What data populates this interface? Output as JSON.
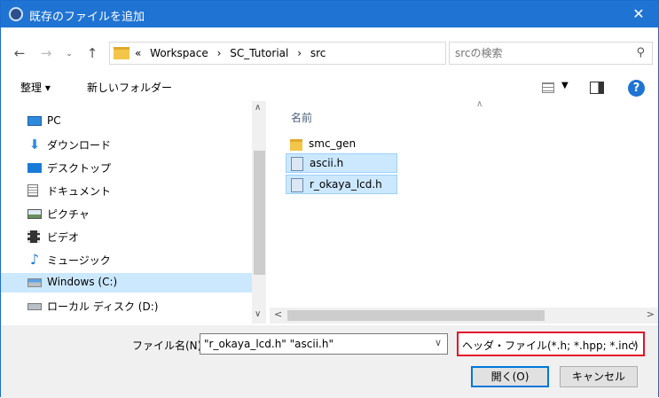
{
  "window": {
    "title": "既存のファイルを追加",
    "close_label": "✕"
  },
  "address": {
    "overflow": "«",
    "crumbs": [
      "Workspace",
      "SC_Tutorial",
      "src"
    ],
    "separator": "›",
    "search_placeholder": "srcの検索"
  },
  "toolbar": {
    "organize": "整理 ▾",
    "new_folder": "新しいフォルダー"
  },
  "nav_items": [
    {
      "label": "PC",
      "icon": "pc-icon"
    },
    {
      "label": "ダウンロード",
      "icon": "download-icon"
    },
    {
      "label": "デスクトップ",
      "icon": "desktop-icon"
    },
    {
      "label": "ドキュメント",
      "icon": "document-icon"
    },
    {
      "label": "ピクチャ",
      "icon": "picture-icon"
    },
    {
      "label": "ビデオ",
      "icon": "video-icon"
    },
    {
      "label": "ミュージック",
      "icon": "music-icon"
    },
    {
      "label": "Windows (C:)",
      "icon": "drive-icon",
      "selected": true
    },
    {
      "label": "ローカル ディスク (D:)",
      "icon": "drive-icon"
    }
  ],
  "files": {
    "column_header": "名前",
    "items": [
      {
        "name": "smc_gen",
        "type": "folder",
        "selected": false
      },
      {
        "name": "ascii.h",
        "type": "file",
        "selected": true
      },
      {
        "name": "r_okaya_lcd.h",
        "type": "file",
        "selected": true
      }
    ]
  },
  "bottom": {
    "filename_label": "ファイル名(N):",
    "filename_value": "\"r_okaya_lcd.h\" \"ascii.h\"",
    "filetype_value": "ヘッダ・ファイル(*.h; *.hpp; *.inc)",
    "open_button": "開く(O)",
    "cancel_button": "キャンセル"
  },
  "colors": {
    "titlebar": "#1f73d2",
    "selection": "#cce8ff",
    "highlight_box": "#e2112a"
  }
}
